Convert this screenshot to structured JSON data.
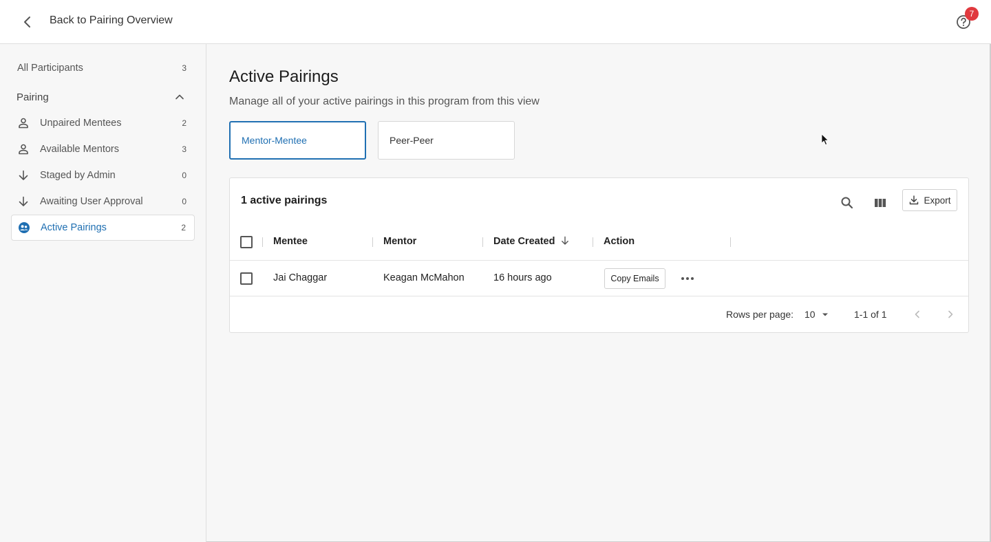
{
  "header": {
    "back_label": "Back to Pairing Overview",
    "notification_count": "7"
  },
  "sidebar": {
    "all_participants": {
      "label": "All Participants",
      "count": "3"
    },
    "section_label": "Pairing",
    "items": [
      {
        "label": "Unpaired Mentees",
        "count": "2",
        "icon": "person-icon"
      },
      {
        "label": "Available Mentors",
        "count": "3",
        "icon": "person-icon"
      },
      {
        "label": "Staged by Admin",
        "count": "0",
        "icon": "arrow-down-icon"
      },
      {
        "label": "Awaiting User Approval",
        "count": "0",
        "icon": "arrow-down-icon"
      },
      {
        "label": "Active Pairings",
        "count": "2",
        "icon": "pairing-icon",
        "active": true
      }
    ]
  },
  "main": {
    "title": "Active Pairings",
    "subtitle": "Manage all of your active pairings in this program from this view",
    "tabs": [
      {
        "label": "Mentor-Mentee",
        "selected": true
      },
      {
        "label": "Peer-Peer",
        "selected": false
      }
    ],
    "table": {
      "summary": "1 active pairings",
      "export_label": "Export",
      "columns": [
        "Mentee",
        "Mentor",
        "Date Created",
        "Action"
      ],
      "rows": [
        {
          "mentee": "Jai Chaggar",
          "mentor": "Keagan McMahon",
          "date_created": "16 hours ago",
          "action_label": "Copy Emails"
        }
      ],
      "pagination": {
        "rows_per_page_label": "Rows per page:",
        "rows_per_page_value": "10",
        "range": "1-1 of 1"
      }
    }
  },
  "colors": {
    "accent": "#1f6fb2",
    "badge": "#e0393e"
  }
}
